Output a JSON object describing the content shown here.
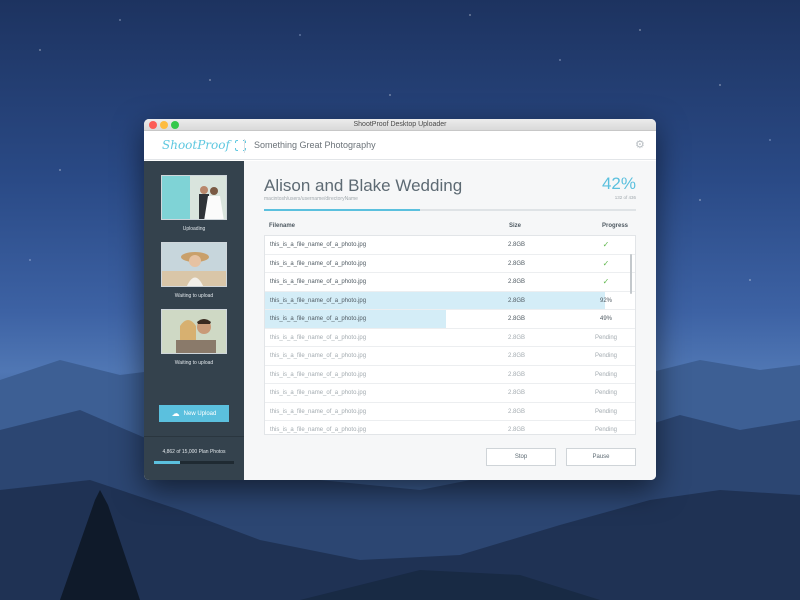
{
  "window": {
    "title": "ShootProof Desktop Uploader"
  },
  "header": {
    "logo_text": "ShootProof",
    "studio_name": "Something Great Photography",
    "settings_icon": "gear-icon"
  },
  "sidebar": {
    "uploads": [
      {
        "status": "Uploading"
      },
      {
        "status": "Waiting to upload"
      },
      {
        "status": "Waiting to upload"
      }
    ],
    "new_upload_label": "New Upload",
    "plan_text": "4,862 of 15,000 Plan Photos",
    "plan_fraction": 0.324
  },
  "job": {
    "title": "Alison and Blake Wedding",
    "path": "macintosh/users/username/directoryName",
    "percent": "42%",
    "percent_value": 0.42,
    "count": "132 of 436"
  },
  "table": {
    "headers": {
      "filename": "Filename",
      "size": "Size",
      "progress": "Progress"
    },
    "rows": [
      {
        "filename": "this_is_a_file_name_of_a_photo.jpg",
        "size": "2.8GB",
        "state": "done",
        "progress": ""
      },
      {
        "filename": "this_is_a_file_name_of_a_photo.jpg",
        "size": "2.8GB",
        "state": "done",
        "progress": ""
      },
      {
        "filename": "this_is_a_file_name_of_a_photo.jpg",
        "size": "2.8GB",
        "state": "done",
        "progress": ""
      },
      {
        "filename": "this_is_a_file_name_of_a_photo.jpg",
        "size": "2.8GB",
        "state": "active",
        "progress": "92%",
        "fraction": 0.92
      },
      {
        "filename": "this_is_a_file_name_of_a_photo.jpg",
        "size": "2.8GB",
        "state": "active",
        "progress": "49%",
        "fraction": 0.49
      },
      {
        "filename": "this_is_a_file_name_of_a_photo.jpg",
        "size": "2.8GB",
        "state": "pending",
        "progress": "Pending"
      },
      {
        "filename": "this_is_a_file_name_of_a_photo.jpg",
        "size": "2.8GB",
        "state": "pending",
        "progress": "Pending"
      },
      {
        "filename": "this_is_a_file_name_of_a_photo.jpg",
        "size": "2.8GB",
        "state": "pending",
        "progress": "Pending"
      },
      {
        "filename": "this_is_a_file_name_of_a_photo.jpg",
        "size": "2.8GB",
        "state": "pending",
        "progress": "Pending"
      },
      {
        "filename": "this_is_a_file_name_of_a_photo.jpg",
        "size": "2.8GB",
        "state": "pending",
        "progress": "Pending"
      },
      {
        "filename": "this_is_a_file_name_of_a_photo.jpg",
        "size": "2.8GB",
        "state": "pending",
        "progress": "Pending"
      }
    ]
  },
  "actions": {
    "stop_label": "Stop",
    "pause_label": "Pause"
  },
  "colors": {
    "accent": "#5bc0de",
    "sidebar_bg": "#34424d",
    "check": "#62b84f",
    "row_highlight": "#d4edf7"
  }
}
